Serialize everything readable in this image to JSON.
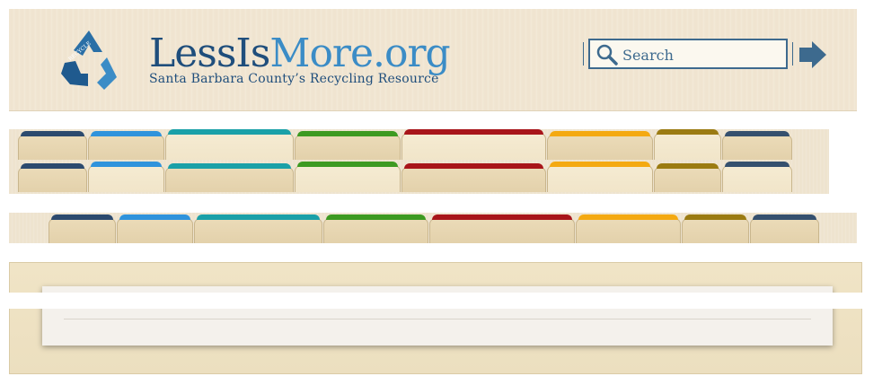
{
  "header": {
    "brand_part1": "Less",
    "brand_part2": "Is",
    "brand_part3": "More.org",
    "tagline": "Santa Barbara County’s Recycling Resource",
    "logo_text": "RECYCLE",
    "search": {
      "placeholder": "Search"
    }
  },
  "tabs_row1": [
    {
      "color": "#2c4a6e"
    },
    {
      "color": "#2f93dc"
    },
    {
      "color": "#1aa0a8"
    },
    {
      "color": "#3d9a21"
    },
    {
      "color": "#a8151a"
    },
    {
      "color": "#f4a911"
    },
    {
      "color": "#9b7b12"
    },
    {
      "color": "#35506e"
    }
  ],
  "tabs_row3": [
    {
      "color": "#2c4a6e"
    },
    {
      "color": "#2f93dc"
    },
    {
      "color": "#1aa0a8"
    },
    {
      "color": "#3d9a21"
    },
    {
      "color": "#a8151a"
    },
    {
      "color": "#f4a911"
    },
    {
      "color": "#9b7b12"
    },
    {
      "color": "#35506e"
    }
  ],
  "colors": {
    "brand_dark": "#1f4e7c",
    "brand_light": "#3b8cc6"
  }
}
